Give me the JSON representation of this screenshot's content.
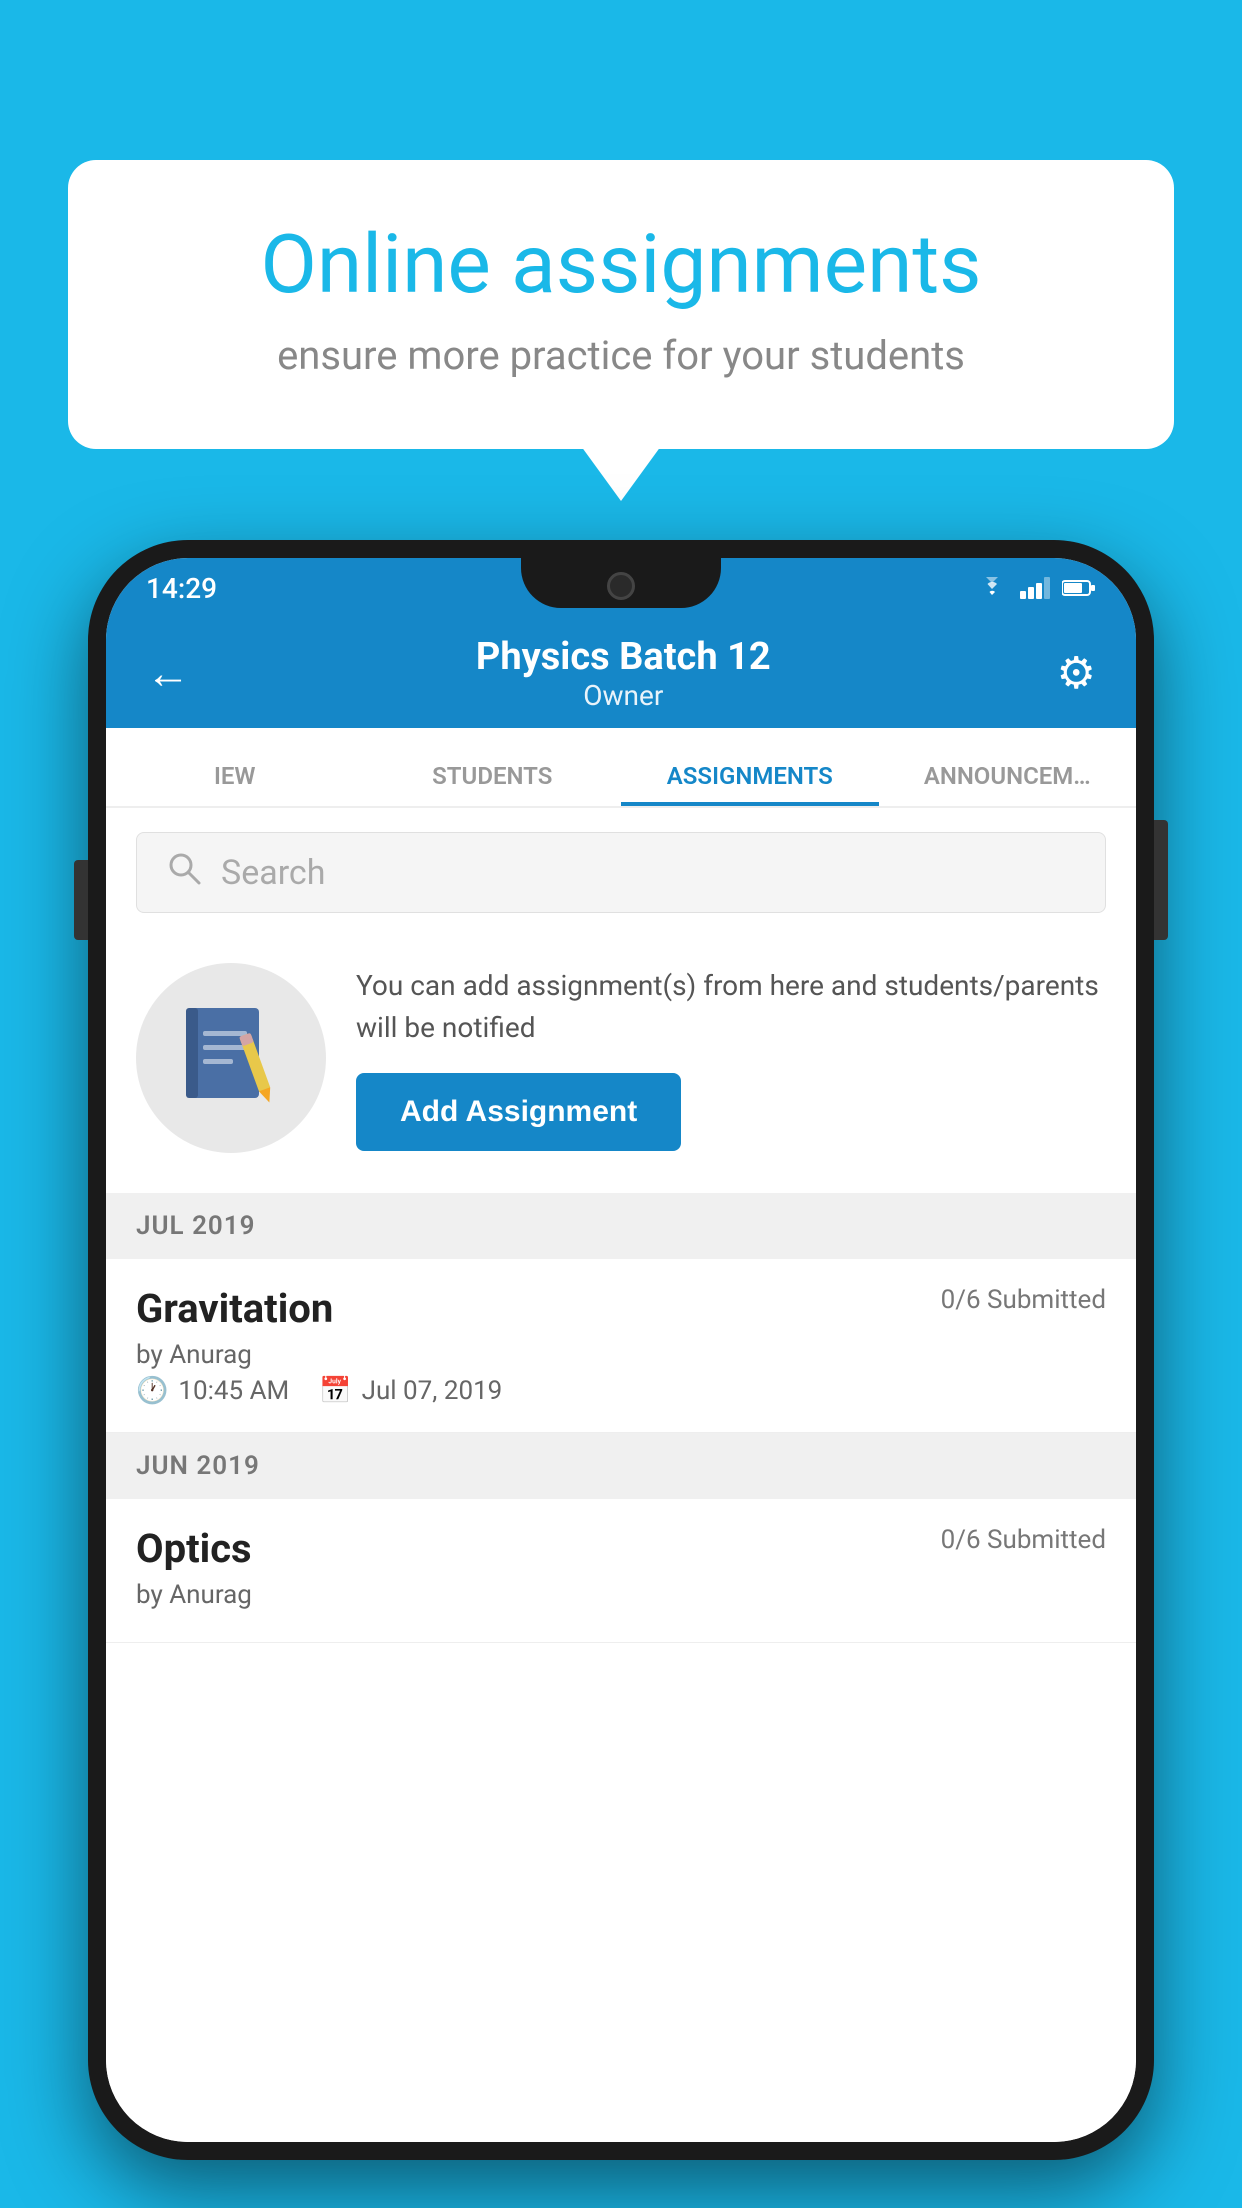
{
  "background_color": "#1ab8e8",
  "speech_bubble": {
    "title": "Online assignments",
    "subtitle": "ensure more practice for your students"
  },
  "status_bar": {
    "time": "14:29",
    "icons": [
      "wifi",
      "signal",
      "battery"
    ]
  },
  "app_bar": {
    "title": "Physics Batch 12",
    "subtitle": "Owner",
    "back_label": "←",
    "settings_label": "⚙"
  },
  "tabs": [
    {
      "label": "IEW",
      "active": false
    },
    {
      "label": "STUDENTS",
      "active": false
    },
    {
      "label": "ASSIGNMENTS",
      "active": true
    },
    {
      "label": "ANNOUNCEM…",
      "active": false
    }
  ],
  "search": {
    "placeholder": "Search"
  },
  "promo": {
    "text": "You can add assignment(s) from here and students/parents will be notified",
    "button_label": "Add Assignment"
  },
  "sections": [
    {
      "label": "JUL 2019",
      "assignments": [
        {
          "name": "Gravitation",
          "submitted": "0/6 Submitted",
          "author": "by Anurag",
          "time": "10:45 AM",
          "date": "Jul 07, 2019"
        }
      ]
    },
    {
      "label": "JUN 2019",
      "assignments": [
        {
          "name": "Optics",
          "submitted": "0/6 Submitted",
          "author": "by Anurag",
          "time": "",
          "date": ""
        }
      ]
    }
  ]
}
